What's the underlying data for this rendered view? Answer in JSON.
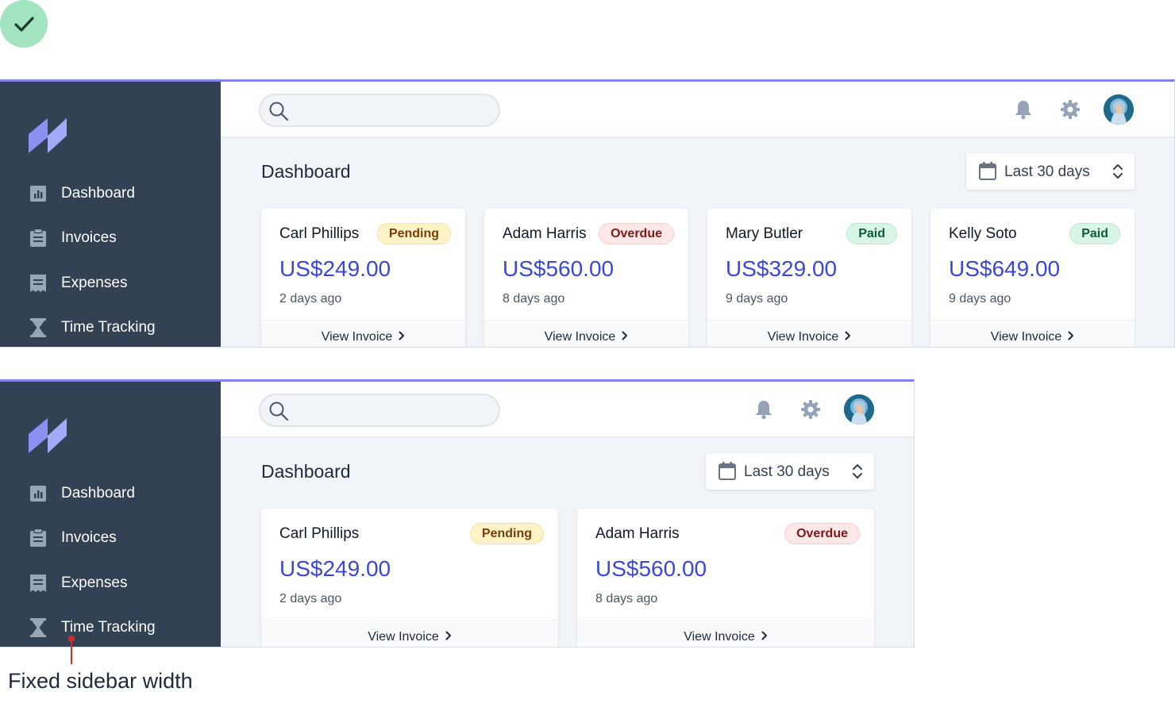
{
  "colors": {
    "accent": "#7f84e6",
    "sidebar": "#334155",
    "amount": "#3b48d4",
    "check_badge": "#a2e4c0"
  },
  "icons": {
    "status": "check-icon",
    "logo": "brand-logo-icon",
    "search": "search-icon",
    "notifications": "bell-icon",
    "settings": "gear-icon",
    "date": "calendar-icon",
    "select": "chevron-up-down-icon",
    "view": "chevron-right-icon"
  },
  "sidebar": {
    "items": [
      {
        "label": "Dashboard",
        "icon": "chart-icon"
      },
      {
        "label": "Invoices",
        "icon": "clipboard-icon"
      },
      {
        "label": "Expenses",
        "icon": "receipt-icon"
      },
      {
        "label": "Time Tracking",
        "icon": "hourglass-icon"
      }
    ]
  },
  "header": {
    "search_placeholder": "",
    "search_value": ""
  },
  "main": {
    "title": "Dashboard",
    "date_range": "Last 30 days"
  },
  "invoices": [
    {
      "name": "Carl Phillips",
      "status": "Pending",
      "amount": "US$249.00",
      "ago": "2 days ago",
      "link": "View Invoice"
    },
    {
      "name": "Adam Harris",
      "status": "Overdue",
      "amount": "US$560.00",
      "ago": "8 days ago",
      "link": "View Invoice"
    },
    {
      "name": "Mary Butler",
      "status": "Paid",
      "amount": "US$329.00",
      "ago": "9 days ago",
      "link": "View Invoice"
    },
    {
      "name": "Kelly Soto",
      "status": "Paid",
      "amount": "US$649.00",
      "ago": "9 days ago",
      "link": "View Invoice"
    }
  ],
  "annotation": {
    "text": "Fixed sidebar width"
  }
}
